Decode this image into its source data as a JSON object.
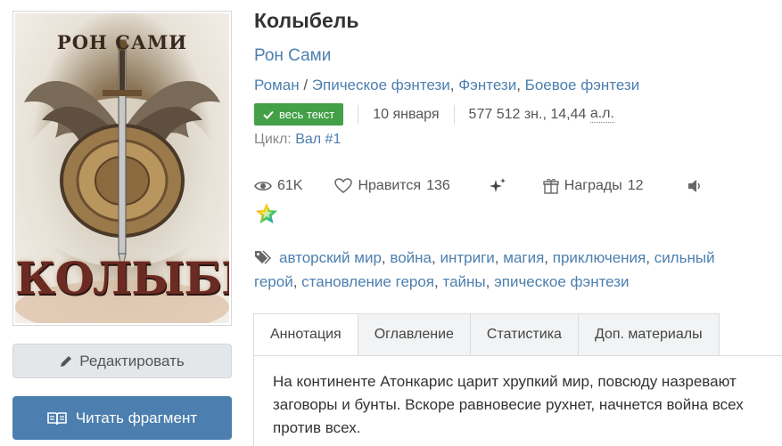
{
  "book": {
    "cover": {
      "author_text": "РОН САМИ",
      "title_text": "КОЛЫБЕЛЬ"
    },
    "title": "Колыбель",
    "author": "Рон Сами",
    "genres": {
      "form": "Роман",
      "separator": "/",
      "items": [
        "Эпическое фэнтези",
        "Фэнтези",
        "Боевое фэнтези"
      ]
    },
    "badge_label": "весь текст",
    "date": "10 января",
    "size": "577 512 зн., 14,44",
    "size_unit": "а.л.",
    "cycle_label": "Цикл:",
    "cycle_value": "Вал #1"
  },
  "stats": {
    "views": "61K",
    "likes_label": "Нравится",
    "likes_count": "136",
    "awards_label": "Награды",
    "awards_count": "12"
  },
  "tags": [
    "авторский мир",
    "война",
    "интриги",
    "магия",
    "приключения",
    "сильный герой",
    "становление героя",
    "тайны",
    "эпическое фэнтези"
  ],
  "actions": {
    "edit_label": "Редактировать",
    "read_label": "Читать фрагмент"
  },
  "tabs": [
    "Аннотация",
    "Оглавление",
    "Статистика",
    "Доп. материалы"
  ],
  "annotation": {
    "line1": "На континенте Атонкарис царит хрупкий мир, повсюду назревают",
    "line2": "заговоры и бунты. Вскоре равновесие рухнет, начнется война всех",
    "line3": "против всех."
  },
  "colors": {
    "link": "#4c7faf",
    "badge": "#43a047",
    "read_button": "#4c7faf",
    "edit_button": "#e4e7ea"
  },
  "icons": [
    "eye-icon",
    "heart-icon",
    "sparkles-icon",
    "gift-icon",
    "speaker-icon",
    "rainbow-star-icon",
    "tag-icon",
    "pencil-icon",
    "book-icon",
    "check-icon"
  ]
}
